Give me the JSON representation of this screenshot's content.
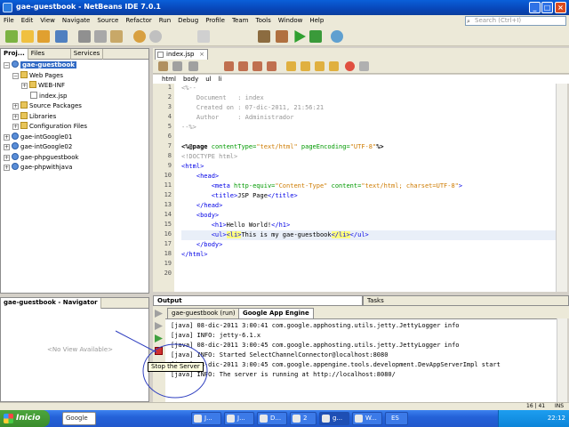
{
  "window": {
    "title": "gae-guestbook - NetBeans IDE 7.0.1"
  },
  "menu": [
    "File",
    "Edit",
    "View",
    "Navigate",
    "Source",
    "Refactor",
    "Run",
    "Debug",
    "Profile",
    "Team",
    "Tools",
    "Window",
    "Help"
  ],
  "search": {
    "placeholder": "Search (Ctrl+I)"
  },
  "left_tabs": [
    "Proj...",
    "Files",
    "Services"
  ],
  "tree": {
    "root": "gae-guestbook",
    "web_pages": "Web Pages",
    "web_inf": "WEB-INF",
    "index": "index.jsp",
    "source_packages": "Source Packages",
    "libraries": "Libraries",
    "config": "Configuration Files",
    "p2": "gae-intGoogle01",
    "p3": "gae-intGoogle02",
    "p4": "gae-phpguestbook",
    "p5": "gae-phpwithjava"
  },
  "navigator": {
    "title": "gae-guestbook - Navigator",
    "empty": "<No View Available>"
  },
  "editor": {
    "tab": "index.jsp",
    "breadcrumb": [
      "html",
      "body",
      "ul",
      "li"
    ],
    "lines": [
      "1",
      "2",
      "3",
      "4",
      "5",
      "6",
      "7",
      "8",
      "9",
      "10",
      "11",
      "12",
      "13",
      "14",
      "15",
      "16",
      "17",
      "18",
      "19",
      "20"
    ]
  },
  "output": {
    "tabs": [
      "Output",
      "Tasks"
    ],
    "subtabs": [
      "gae-guestbook (run)",
      "Google App Engine"
    ],
    "lines": [
      "[java] 08-dic-2011 3:00:41 com.google.apphosting.utils.jetty.JettyLogger info",
      "[java] INFO: jetty-6.1.x",
      "[java] 08-dic-2011 3:00:45 com.google.apphosting.utils.jetty.JettyLogger info",
      "[java] INFO: Started SelectChannelConnector@localhost:8080",
      "[java] 08-dic-2011 3:00:45 com.google.appengine.tools.development.DevAppServerImpl start",
      "[java] INFO: The server is running at http://localhost:8080/"
    ],
    "tooltip": "Stop the Server"
  },
  "status": {
    "position": "16 | 41",
    "mode": "INS"
  },
  "taskbar": {
    "start": "Inicio",
    "search": "Google",
    "items": [
      "J...",
      "J...",
      "D...",
      "2",
      "g...",
      "W...",
      "ES"
    ],
    "time": "22:12"
  }
}
